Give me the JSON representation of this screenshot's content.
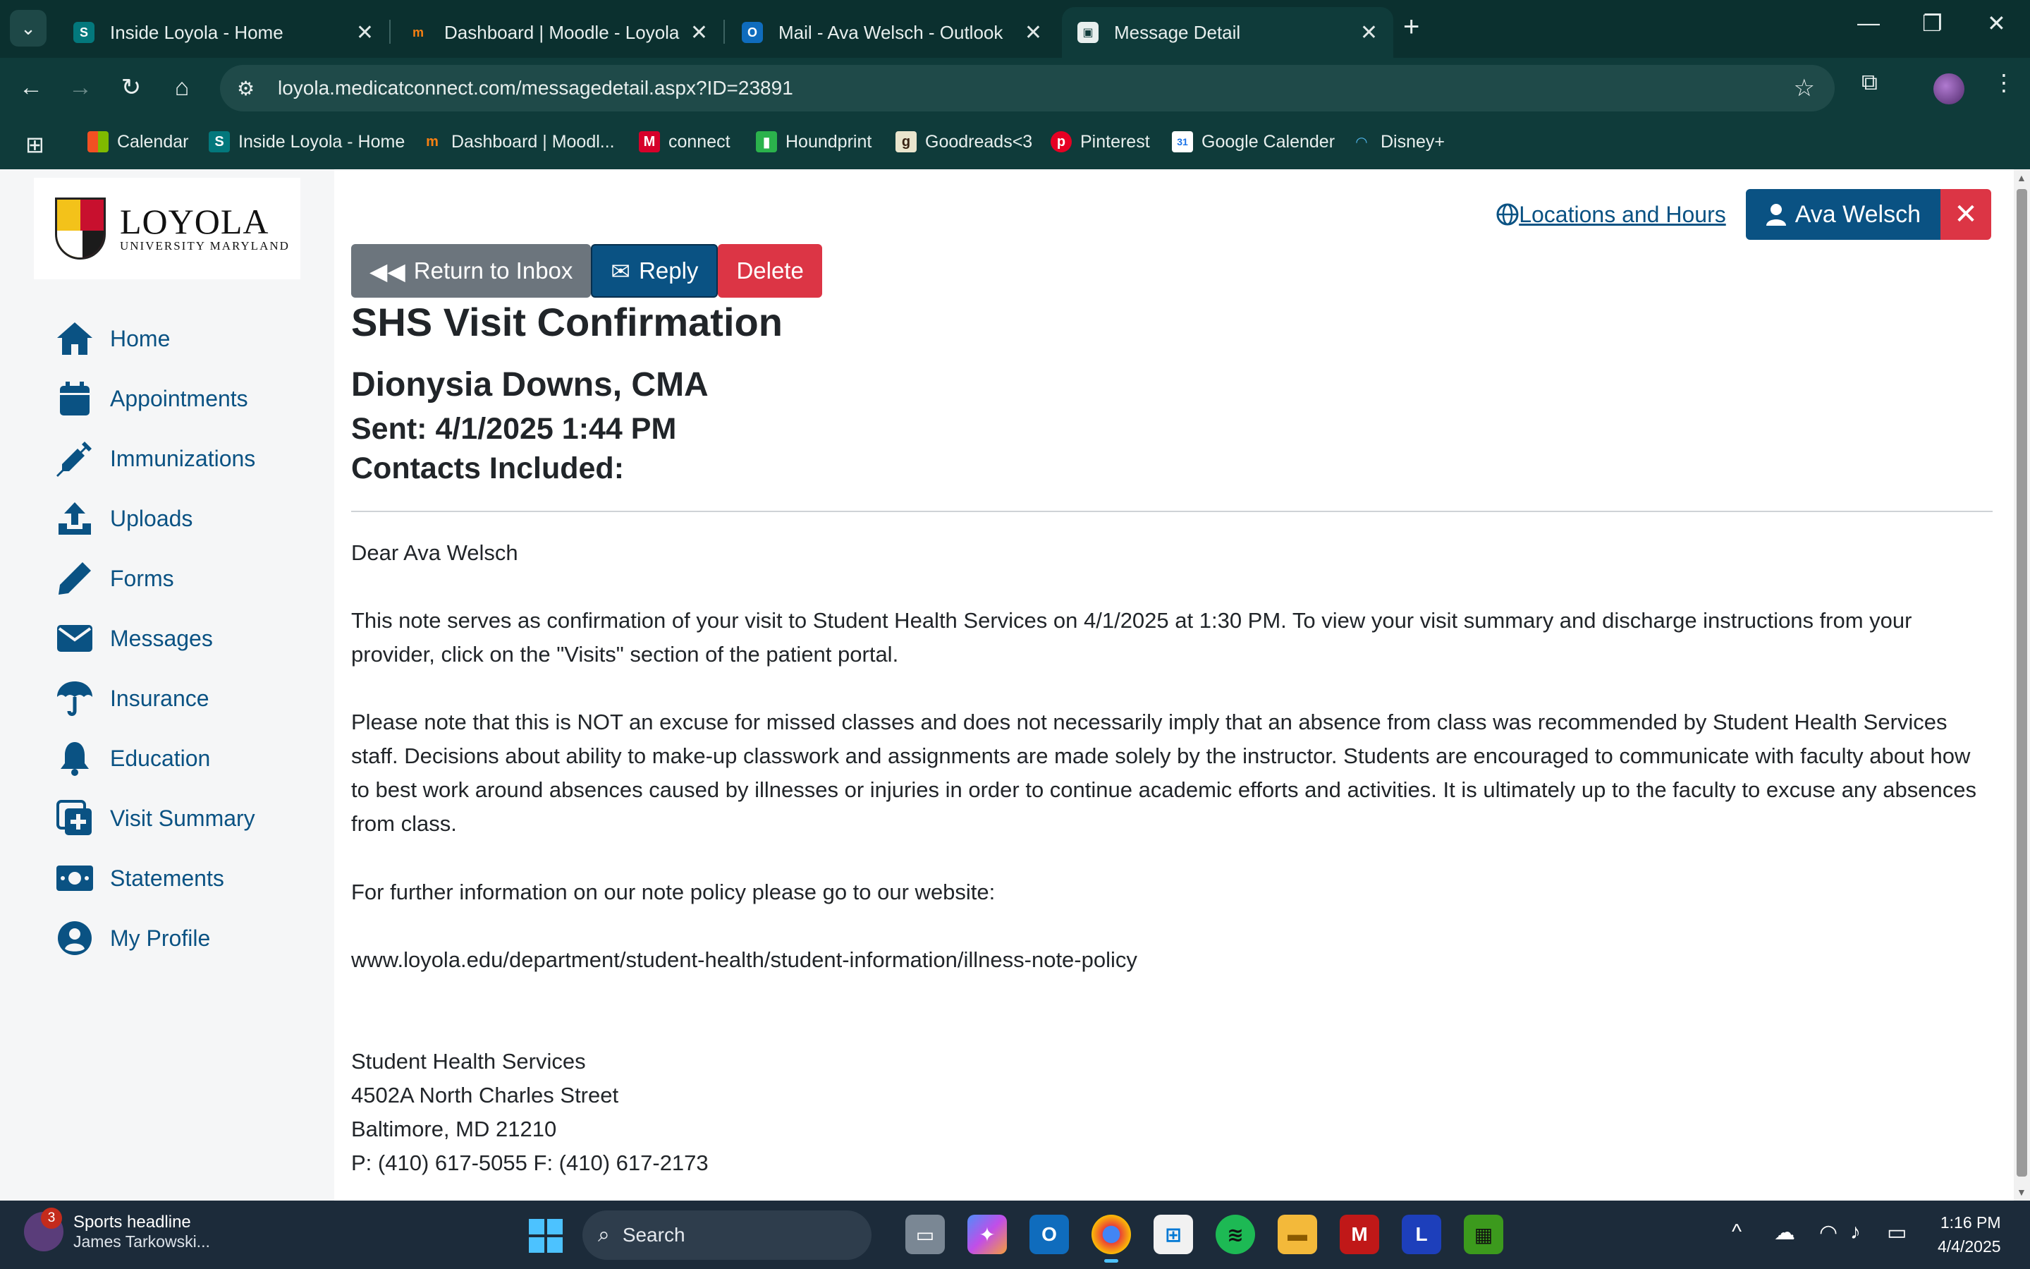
{
  "browser": {
    "tabs": [
      {
        "title": "Inside Loyola - Home",
        "active": false
      },
      {
        "title": "Dashboard | Moodle - Loyola U",
        "active": false
      },
      {
        "title": "Mail - Ava Welsch - Outlook",
        "active": false
      },
      {
        "title": "Message Detail",
        "active": true
      }
    ],
    "url": "loyola.medicatconnect.com/messagedetail.aspx?ID=23891",
    "bookmarks": [
      {
        "label": "Calendar",
        "icon": "windows-calendar-icon"
      },
      {
        "label": "Inside Loyola - Home",
        "icon": "sharepoint-icon"
      },
      {
        "label": "Dashboard | Moodl...",
        "icon": "moodle-icon"
      },
      {
        "label": "connect",
        "icon": "mcgraw-hill-icon"
      },
      {
        "label": "Houndprint",
        "icon": "houndprint-icon"
      },
      {
        "label": "Goodreads<3",
        "icon": "goodreads-icon"
      },
      {
        "label": "Pinterest",
        "icon": "pinterest-icon"
      },
      {
        "label": "Google Calender",
        "icon": "google-calendar-icon"
      },
      {
        "label": "Disney+",
        "icon": "disney-plus-icon"
      }
    ]
  },
  "logo": {
    "name": "LOYOLA",
    "subtitle": "UNIVERSITY MARYLAND"
  },
  "sidebar": {
    "items": [
      {
        "label": "Home",
        "icon": "home-icon"
      },
      {
        "label": "Appointments",
        "icon": "calendar-icon"
      },
      {
        "label": "Immunizations",
        "icon": "syringe-icon"
      },
      {
        "label": "Uploads",
        "icon": "upload-icon"
      },
      {
        "label": "Forms",
        "icon": "pencil-icon"
      },
      {
        "label": "Messages",
        "icon": "envelope-icon"
      },
      {
        "label": "Insurance",
        "icon": "umbrella-icon"
      },
      {
        "label": "Education",
        "icon": "bell-icon"
      },
      {
        "label": "Visit Summary",
        "icon": "medical-plus-icon"
      },
      {
        "label": "Statements",
        "icon": "money-icon"
      },
      {
        "label": "My Profile",
        "icon": "user-circle-icon"
      }
    ]
  },
  "header": {
    "locations_link": " Locations and Hours",
    "user_name": "Ava Welsch",
    "close_symbol": "✕"
  },
  "actions": {
    "return_label": "Return to Inbox",
    "reply_label": "Reply",
    "delete_label": "Delete"
  },
  "message": {
    "title": "SHS Visit Confirmation",
    "sender": "Dionysia Downs, CMA",
    "sent": "Sent: 4/1/2025 1:44 PM",
    "contacts": "Contacts Included:",
    "greeting": "Dear Ava Welsch",
    "paragraph1": "This note serves as confirmation of your visit to Student Health Services on 4/1/2025 at 1:30 PM. To view your visit summary and discharge instructions from your provider, click on the \"Visits\" section of the patient portal.",
    "paragraph2": "Please note that this is NOT an excuse for missed classes and does not necessarily imply that an absence from class was recommended by Student Health Services staff. Decisions about ability to make-up classwork and assignments are made solely by the instructor. Students are encouraged to communicate with faculty about how to best work around absences caused by illnesses or injuries in order to continue academic efforts and activities. It is ultimately up to the faculty to excuse any absences from class.",
    "paragraph3": "For further information on our note policy please go to our website:",
    "website": "www.loyola.edu/department/student-health/student-information/illness-note-policy",
    "signature": {
      "org": "Student Health Services",
      "street": "4502A North Charles Street",
      "city": "Baltimore, MD 21210",
      "phone": "P: (410) 617-5055 F: (410) 617-2173"
    }
  },
  "taskbar": {
    "news_title": "Sports headline",
    "news_sub": "James Tarkowski...",
    "news_badge": "3",
    "search_placeholder": "Search",
    "time": "1:16 PM",
    "date": "4/4/2025"
  }
}
